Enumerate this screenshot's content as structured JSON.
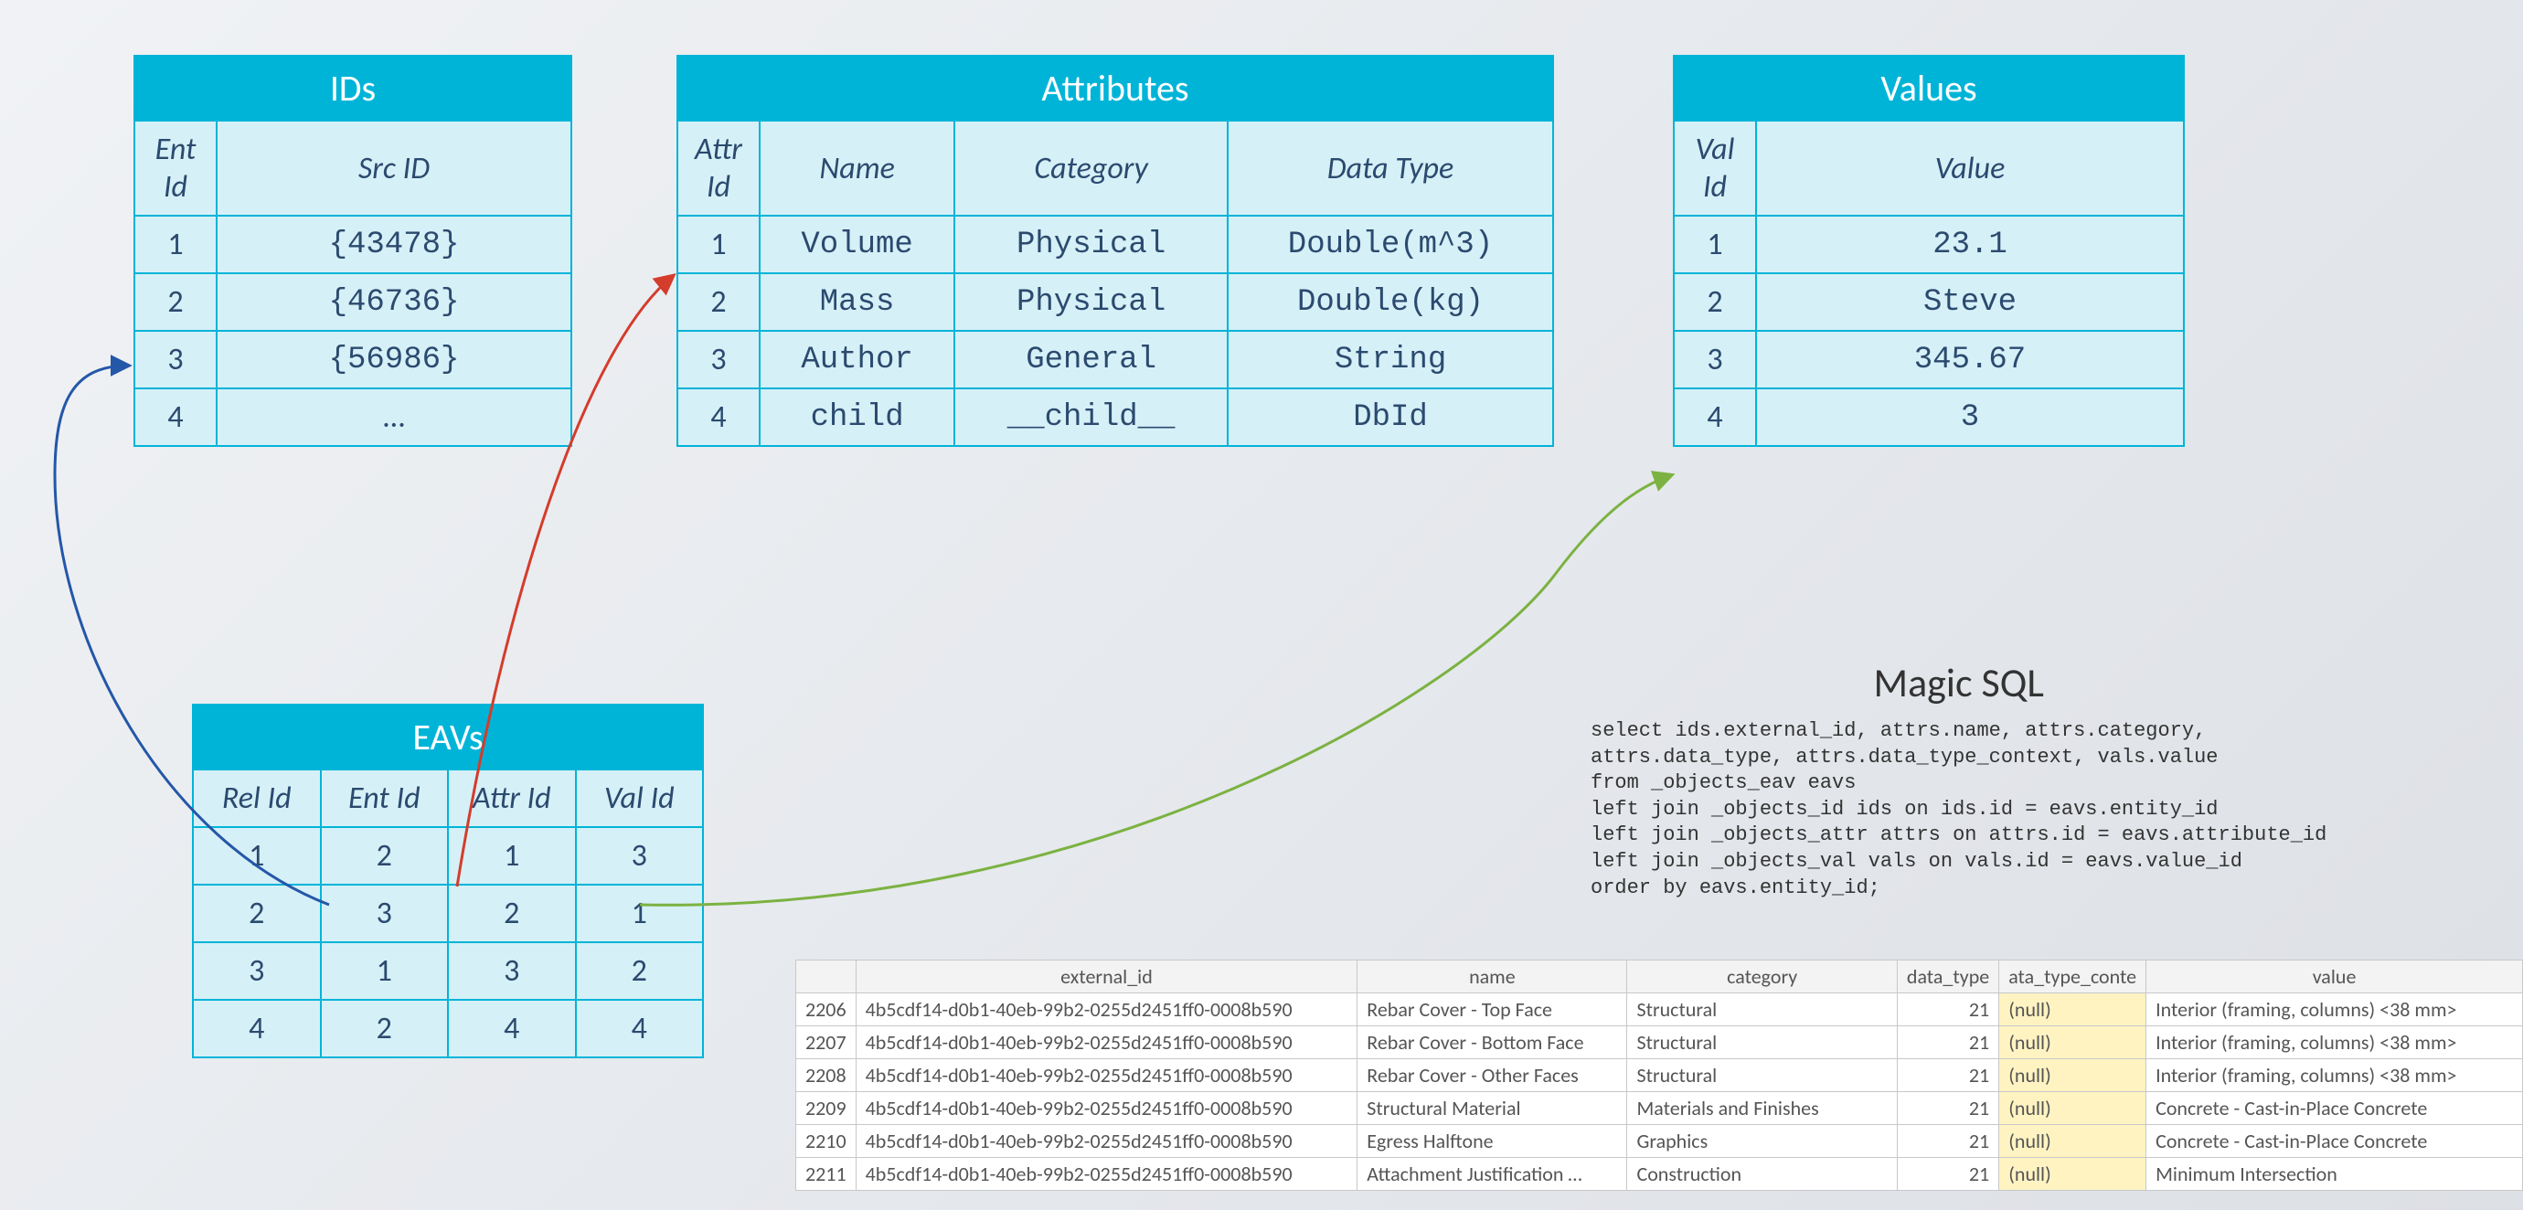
{
  "tables": {
    "ids": {
      "title": "IDs",
      "headers": [
        "Ent Id",
        "Src ID"
      ],
      "rows": [
        [
          "1",
          "{43478}"
        ],
        [
          "2",
          "{46736}"
        ],
        [
          "3",
          "{56986}"
        ],
        [
          "4",
          "…"
        ]
      ]
    },
    "attributes": {
      "title": "Attributes",
      "headers": [
        "Attr Id",
        "Name",
        "Category",
        "Data Type"
      ],
      "rows": [
        [
          "1",
          "Volume",
          "Physical",
          "Double(m^3)"
        ],
        [
          "2",
          "Mass",
          "Physical",
          "Double(kg)"
        ],
        [
          "3",
          "Author",
          "General",
          "String"
        ],
        [
          "4",
          "child",
          "__child__",
          "DbId"
        ]
      ]
    },
    "values": {
      "title": "Values",
      "headers": [
        "Val Id",
        "Value"
      ],
      "rows": [
        [
          "1",
          "23.1"
        ],
        [
          "2",
          "Steve"
        ],
        [
          "3",
          "345.67"
        ],
        [
          "4",
          "3"
        ]
      ]
    },
    "eavs": {
      "title": "EAVs",
      "headers": [
        "Rel Id",
        "Ent Id",
        "Attr Id",
        "Val Id"
      ],
      "rows": [
        [
          "1",
          "2",
          "1",
          "3"
        ],
        [
          "2",
          "3",
          "2",
          "1"
        ],
        [
          "3",
          "1",
          "3",
          "2"
        ],
        [
          "4",
          "2",
          "4",
          "4"
        ]
      ]
    }
  },
  "sql": {
    "title": "Magic SQL",
    "code": "select ids.external_id, attrs.name, attrs.category,\nattrs.data_type, attrs.data_type_context, vals.value\nfrom _objects_eav eavs\nleft join _objects_id ids on ids.id = eavs.entity_id\nleft join _objects_attr attrs on attrs.id = eavs.attribute_id\nleft join _objects_val vals on vals.id = eavs.value_id\norder by eavs.entity_id;"
  },
  "results": {
    "headers": [
      "",
      "external_id",
      "name",
      "category",
      "data_type",
      "ata_type_conte",
      "value"
    ],
    "rows": [
      [
        "2206",
        "4b5cdf14-d0b1-40eb-99b2-0255d2451ff0-0008b590",
        "Rebar Cover - Top Face",
        "Structural",
        "21",
        "(null)",
        "Interior (framing, columns) <38 mm>"
      ],
      [
        "2207",
        "4b5cdf14-d0b1-40eb-99b2-0255d2451ff0-0008b590",
        "Rebar Cover - Bottom Face",
        "Structural",
        "21",
        "(null)",
        "Interior (framing, columns) <38 mm>"
      ],
      [
        "2208",
        "4b5cdf14-d0b1-40eb-99b2-0255d2451ff0-0008b590",
        "Rebar Cover - Other Faces",
        "Structural",
        "21",
        "(null)",
        "Interior (framing, columns) <38 mm>"
      ],
      [
        "2209",
        "4b5cdf14-d0b1-40eb-99b2-0255d2451ff0-0008b590",
        "Structural Material",
        "Materials and Finishes",
        "21",
        "(null)",
        "Concrete - Cast-in-Place Concrete"
      ],
      [
        "2210",
        "4b5cdf14-d0b1-40eb-99b2-0255d2451ff0-0008b590",
        "Egress Halftone",
        "Graphics",
        "21",
        "(null)",
        "Concrete - Cast-in-Place Concrete"
      ],
      [
        "2211",
        "4b5cdf14-d0b1-40eb-99b2-0255d2451ff0-0008b590",
        "Attachment Justification …",
        "Construction",
        "21",
        "(null)",
        "Minimum Intersection"
      ]
    ]
  }
}
